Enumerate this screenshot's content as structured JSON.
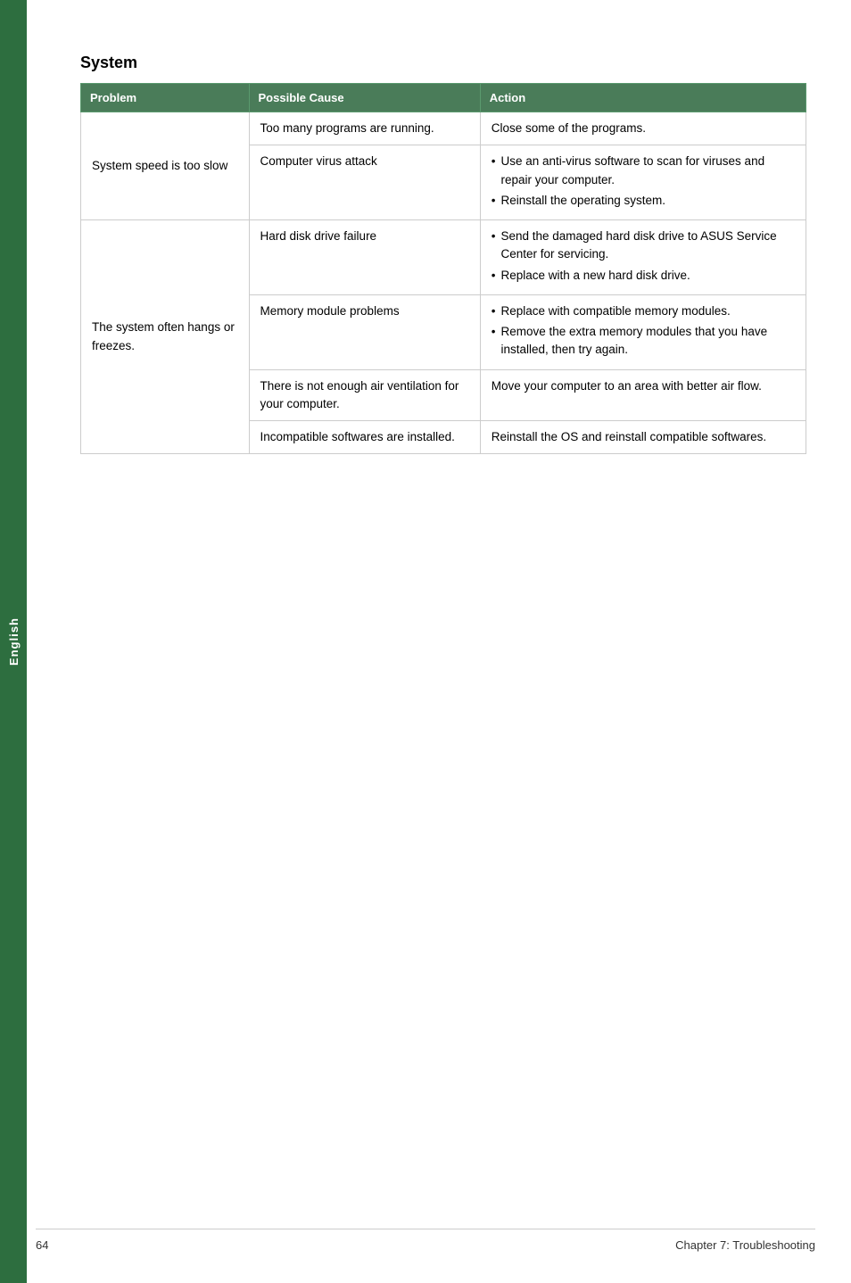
{
  "sidebar": {
    "label": "English"
  },
  "section": {
    "title": "System"
  },
  "table": {
    "headers": {
      "problem": "Problem",
      "cause": "Possible Cause",
      "action": "Action"
    },
    "rows": [
      {
        "problem": "System speed is too slow",
        "cause": "Too many programs are running.",
        "action_type": "text",
        "action": "Close some of the programs."
      },
      {
        "problem": "",
        "cause": "Computer virus attack",
        "action_type": "bullets",
        "action_bullets": [
          "Use an anti-virus software to scan for viruses and repair your computer.",
          "Reinstall the operating system."
        ]
      },
      {
        "problem": "The system often hangs or freezes.",
        "cause": "Hard disk drive failure",
        "action_type": "bullets",
        "action_bullets": [
          "Send the damaged hard disk drive to ASUS Service Center for servicing.",
          "Replace with a new hard disk drive."
        ]
      },
      {
        "problem": "",
        "cause": "Memory module problems",
        "action_type": "bullets",
        "action_bullets": [
          "Replace with compatible memory modules.",
          "Remove the extra memory modules that you have installed, then try again."
        ]
      },
      {
        "problem": "",
        "cause": "There is not enough air ventilation for your computer.",
        "action_type": "text",
        "action": "Move your computer to an area with better air flow."
      },
      {
        "problem": "",
        "cause": "Incompatible softwares are installed.",
        "action_type": "text",
        "action": "Reinstall the OS and reinstall compatible softwares."
      }
    ]
  },
  "footer": {
    "page_number": "64",
    "chapter": "Chapter 7: Troubleshooting"
  }
}
